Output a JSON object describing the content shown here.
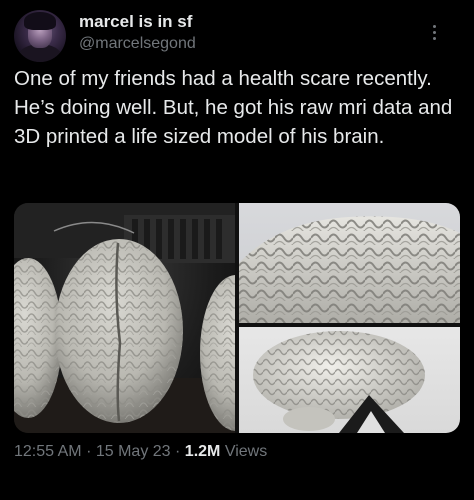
{
  "user": {
    "display_name": "marcel is in sf",
    "handle": "@marcelsegond"
  },
  "tweet": {
    "text": "One of my friends had a health scare recently. He’s doing well. But, he got his raw mri data and 3D printed a life sized model of his brain."
  },
  "media": {
    "photos": [
      {
        "icon": "brain-models-photo"
      },
      {
        "icon": "brain-closeup-photo"
      },
      {
        "icon": "brain-on-stand-photo"
      }
    ]
  },
  "meta": {
    "time": "12:55 AM",
    "separator": "·",
    "date": "15 May 23",
    "views_count": "1.2M",
    "views_label": "Views"
  },
  "colors": {
    "background": "#000000",
    "text_primary": "#e7e9ea",
    "text_secondary": "#71767b"
  }
}
